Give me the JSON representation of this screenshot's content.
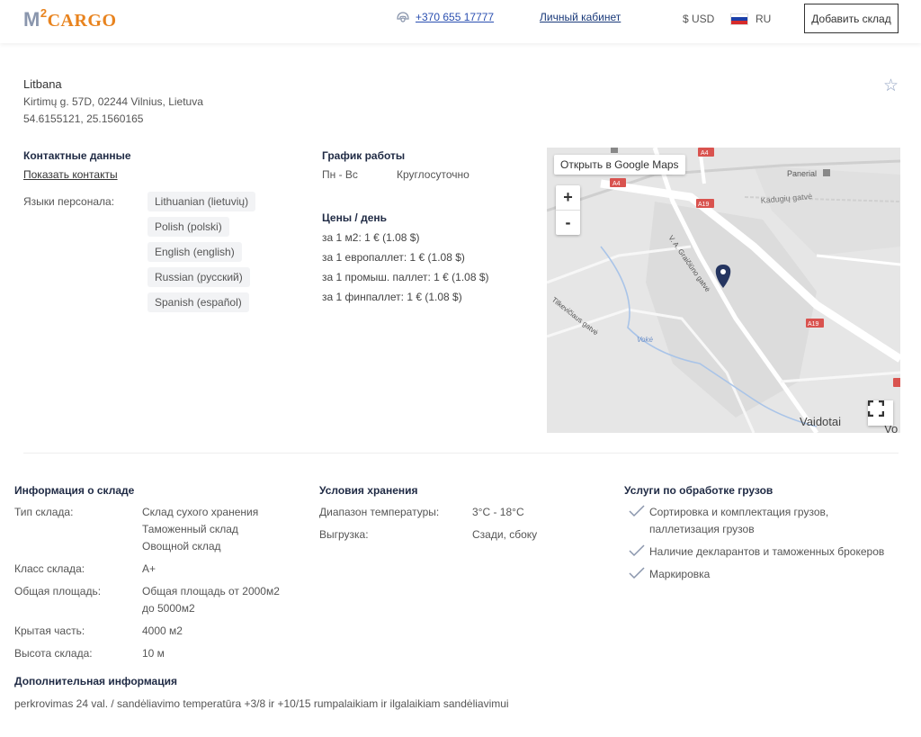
{
  "header": {
    "logo_m": "M",
    "logo_sup": "2",
    "logo_cargo": "CARGO",
    "phone": "+370 655 17777",
    "cabinet": "Личный кабинет",
    "currency": "$ USD",
    "language": "RU",
    "add_button": "Добавить склад"
  },
  "warehouse": {
    "name": "Litbana",
    "address": "Kirtimų g. 57D, 02244 Vilnius, Lietuva",
    "coords": "54.6155121, 25.1560165"
  },
  "contacts": {
    "title": "Контактные данные",
    "show": "Показать контакты",
    "languages_label": "Языки персонала:",
    "languages": [
      "Lithuanian (lietuvių)",
      "Polish (polski)",
      "English (english)",
      "Russian (русский)",
      "Spanish (español)"
    ]
  },
  "schedule": {
    "title": "График работы",
    "days": "Пн - Вс",
    "hours": "Круглосуточно"
  },
  "prices": {
    "title": "Цены / день",
    "items": [
      "за 1 м2:  1 € (1.08 $)",
      "за 1 европаллет:  1 € (1.08 $)",
      "за 1 промыш. паллет:  1 € (1.08 $)",
      "за 1 финпаллет:  1 € (1.08 $)"
    ]
  },
  "map": {
    "open_label": "Открыть в Google Maps",
    "zoom_in": "+",
    "zoom_out": "-",
    "labels": {
      "panerial": "Panerial",
      "kaduglu": "Kadugių gatvė",
      "a4_top": "A4",
      "a4": "A4",
      "a19_a": "A19",
      "a19_b": "A19",
      "vokes": "Vokė",
      "grafu": "V. A. Graičiūno gatvė",
      "tiltu": "Tilkevičiaus gatvė",
      "vaidotai": "Vaidotai",
      "edge": "Vo"
    }
  },
  "info": {
    "title": "Информация о складе",
    "type_label": "Тип склада:",
    "types": [
      "Склад сухого хранения",
      "Таможенный склад",
      "Овощной склад"
    ],
    "class_label": "Класс склада:",
    "class_value": "A+",
    "area_label": "Общая площадь:",
    "area_value_1": "Общая площадь от 2000м2",
    "area_value_2": "до 5000м2",
    "covered_label": "Крытая часть:",
    "covered_value": "4000 м2",
    "height_label": "Высота склада:",
    "height_value": "10 м"
  },
  "storage": {
    "title": "Условия хранения",
    "temp_label": "Диапазон температуры:",
    "temp_value": "3°C - 18°C",
    "unload_label": "Выгрузка:",
    "unload_value": "Сзади, сбоку"
  },
  "services": {
    "title": "Услуги по обработке грузов",
    "items": [
      [
        "Сортировка и комплектация грузов,",
        "паллетизация грузов"
      ],
      [
        "Наличие декларантов и таможенных брокеров"
      ],
      [
        "Маркировка"
      ]
    ]
  },
  "additional": {
    "title": "Дополнительная информация",
    "text": "perkrovimas 24 val. / sandėliavimo temperatūra +3/8 ir +10/15 rumpalaikiam ir ilgalaikiam sandėliavimui"
  },
  "colors": {
    "accent": "#e8831e",
    "logo_gray": "#8a96ad",
    "heading": "#1f2a44",
    "marker": "#253560"
  }
}
